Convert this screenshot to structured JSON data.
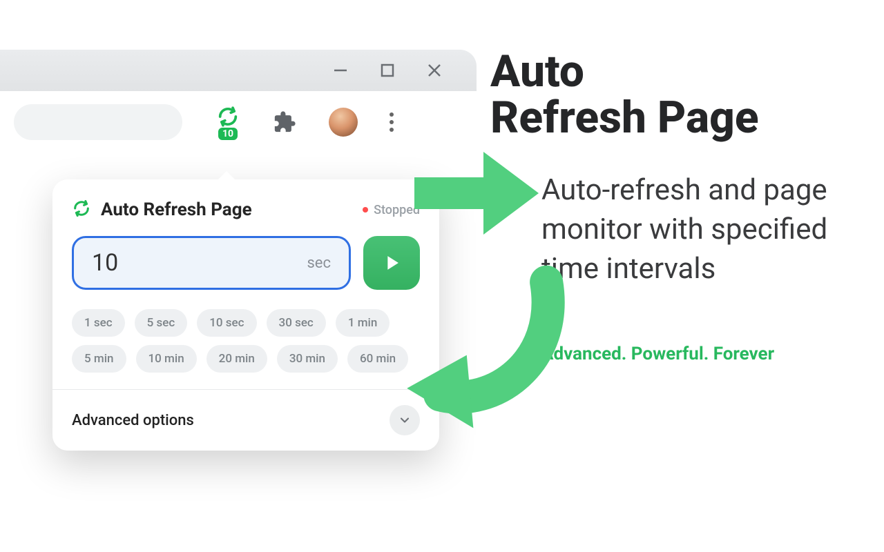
{
  "browser": {
    "extension_badge": "10"
  },
  "popup": {
    "title": "Auto Refresh Page",
    "status_label": "Stopped",
    "interval_value": "10",
    "interval_unit": "sec",
    "advanced_label": "Advanced options",
    "presets": [
      "1 sec",
      "5 sec",
      "10 sec",
      "30 sec",
      "1 min",
      "5 min",
      "10 min",
      "20 min",
      "30 min",
      "60 min"
    ]
  },
  "hero": {
    "title_line1": "Auto",
    "title_line2": "Refresh Page",
    "subtitle": "Auto-refresh and page monitor with specified time intervals",
    "tagline": "Advanced. Powerful. Forever"
  }
}
